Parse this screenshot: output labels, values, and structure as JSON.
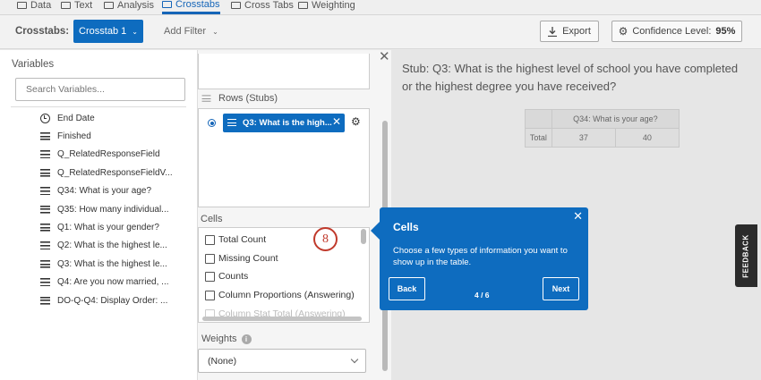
{
  "topnav": {
    "tabs": [
      {
        "label": "Data",
        "icon": "data-icon"
      },
      {
        "label": "Text",
        "icon": "text-icon"
      },
      {
        "label": "Analysis",
        "icon": "analysis-icon"
      },
      {
        "label": "Crosstabs",
        "icon": "crosstabs-icon",
        "active": true
      },
      {
        "label": "Cross Tabs",
        "icon": "grid-icon"
      },
      {
        "label": "Weighting",
        "icon": "scale-icon"
      }
    ]
  },
  "toolbar": {
    "label": "Crosstabs:",
    "crosstab_selected": "Crosstab 1",
    "add_filter": "Add Filter",
    "export": "Export",
    "confidence_label": "Confidence Level:",
    "confidence_value": "95%"
  },
  "sidebar": {
    "title": "Variables",
    "search_placeholder": "Search Variables...",
    "items": [
      {
        "label": "End Date",
        "icon": "clock-icon"
      },
      {
        "label": "Finished",
        "icon": "list-icon"
      },
      {
        "label": "Q_RelatedResponseField",
        "icon": "list-icon"
      },
      {
        "label": "Q_RelatedResponseFieldV...",
        "icon": "list-icon"
      },
      {
        "label": "Q34: What is your age?",
        "icon": "list-icon"
      },
      {
        "label": "Q35: How many individual...",
        "icon": "list-icon"
      },
      {
        "label": "Q1: What is your gender?",
        "icon": "list-icon"
      },
      {
        "label": "Q2: What is the highest le...",
        "icon": "list-icon"
      },
      {
        "label": "Q3: What is the highest le...",
        "icon": "list-icon"
      },
      {
        "label": "Q4: Are you now married, ...",
        "icon": "list-icon"
      },
      {
        "label": "DO-Q-Q4: Display Order: ...",
        "icon": "list-icon"
      }
    ]
  },
  "config": {
    "rows_label": "Rows (Stubs)",
    "row_chip": "Q3: What is the high...",
    "cells_label": "Cells",
    "cells": [
      "Total Count",
      "Missing Count",
      "Counts",
      "Column Proportions (Answering)"
    ],
    "cells_cut": "Column Stat Total (Answering)",
    "weights_label": "Weights",
    "weights_value": "(None)"
  },
  "step_marker": "8",
  "tooltip": {
    "title": "Cells",
    "body": "Choose a few types of information you want to show up in the table.",
    "back": "Back",
    "next": "Next",
    "counter": "4 / 6"
  },
  "main": {
    "stub_title": "Stub: Q3: What is the highest level of school you have completed or the highest degree you have received?",
    "table_header": "Q34: What is your age?",
    "table_row": [
      "Total",
      "37",
      "40"
    ]
  },
  "feedback": "FEEDBACK"
}
